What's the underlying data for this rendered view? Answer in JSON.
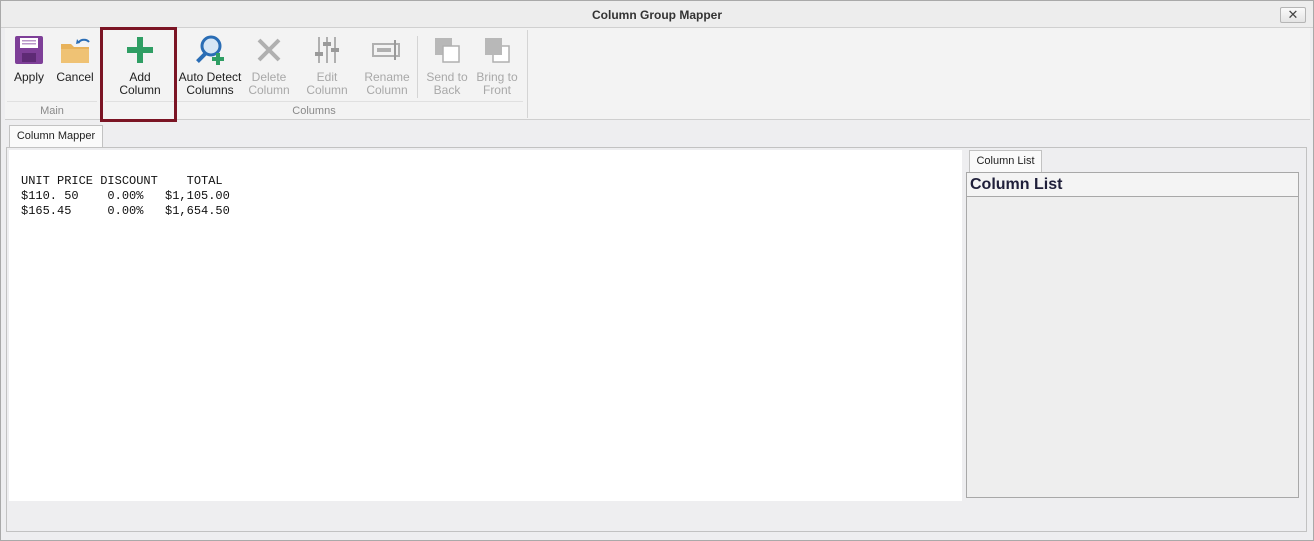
{
  "window": {
    "title": "Column Group Mapper",
    "close_label": "✕"
  },
  "ribbon": {
    "groups": {
      "main": "Main",
      "columns": "Columns"
    },
    "buttons": {
      "apply": "Apply",
      "cancel": "Cancel",
      "add_column": "Add Column",
      "auto_detect_1": "Auto Detect",
      "auto_detect_2": "Columns",
      "delete_1": "Delete",
      "delete_2": "Column",
      "edit_column": "Edit Column",
      "rename_1": "Rename",
      "rename_2": "Column",
      "send_back_1": "Send to",
      "send_back_2": "Back",
      "bring_front_1": "Bring to",
      "bring_front_2": "Front"
    }
  },
  "tabs": {
    "main": "Column Mapper",
    "side": "Column List"
  },
  "document": {
    "lines": [
      "UNIT PRICE DISCOUNT    TOTAL",
      "$110. 50    0.00%   $1,105.00",
      "$165.45     0.00%   $1,654.50"
    ]
  },
  "side_panel": {
    "title": "Column List",
    "items": []
  },
  "colors": {
    "highlight_border": "#7b1424",
    "apply_icon": "#7e3f98",
    "cancel_icon": "#e8b25a",
    "add_icon": "#2f9e64",
    "auto_detect_icon": "#2a6db5",
    "disabled_icon": "#b0b0b0"
  }
}
